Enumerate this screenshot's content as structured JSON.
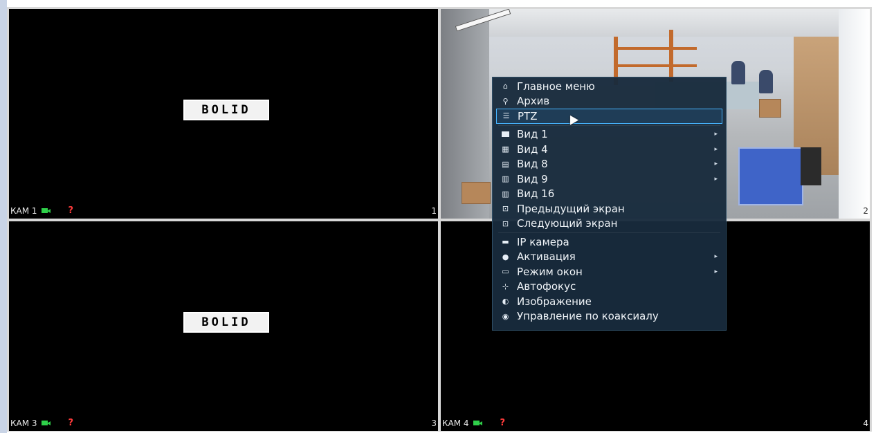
{
  "tiles": [
    {
      "label": "КАМ 1",
      "number": "1",
      "logo": "BOLID"
    },
    {
      "number": "2"
    },
    {
      "label": "КАМ 3",
      "number": "3",
      "logo": "BOLID"
    },
    {
      "label": "КАМ 4",
      "number": "4"
    }
  ],
  "status_icons": {
    "record": "camera-record-icon",
    "unknown": "?"
  },
  "context_menu": {
    "items": [
      {
        "label": "Главное меню",
        "icon": "home-icon"
      },
      {
        "label": "Архив",
        "icon": "search-icon"
      },
      {
        "label": "PTZ",
        "icon": "ptz-icon",
        "selected": true
      },
      {
        "label": "Вид 1",
        "icon": "view1-icon",
        "submenu": true
      },
      {
        "label": "Вид 4",
        "icon": "view4-icon",
        "submenu": true
      },
      {
        "label": "Вид 8",
        "icon": "view8-icon",
        "submenu": true
      },
      {
        "label": "Вид 9",
        "icon": "view9-icon",
        "submenu": true
      },
      {
        "label": "Вид 16",
        "icon": "view16-icon"
      },
      {
        "label": "Предыдущий экран",
        "icon": "prev-screen-icon"
      },
      {
        "label": "Следующий экран",
        "icon": "next-screen-icon"
      },
      {
        "label": "IP камера",
        "icon": "ip-camera-icon"
      },
      {
        "label": "Активация",
        "icon": "activation-icon",
        "submenu": true
      },
      {
        "label": "Режим окон",
        "icon": "window-mode-icon",
        "submenu": true
      },
      {
        "label": "Автофокус",
        "icon": "autofocus-icon"
      },
      {
        "label": "Изображение",
        "icon": "image-icon"
      },
      {
        "label": "Управление по коаксиалу",
        "icon": "coaxial-control-icon"
      }
    ],
    "submenu_arrow": "▸"
  },
  "colors": {
    "accent": "#47b4ff",
    "menu_bg": "#182b3c",
    "record": "#2fd04a",
    "warning": "#ff3b3b"
  }
}
